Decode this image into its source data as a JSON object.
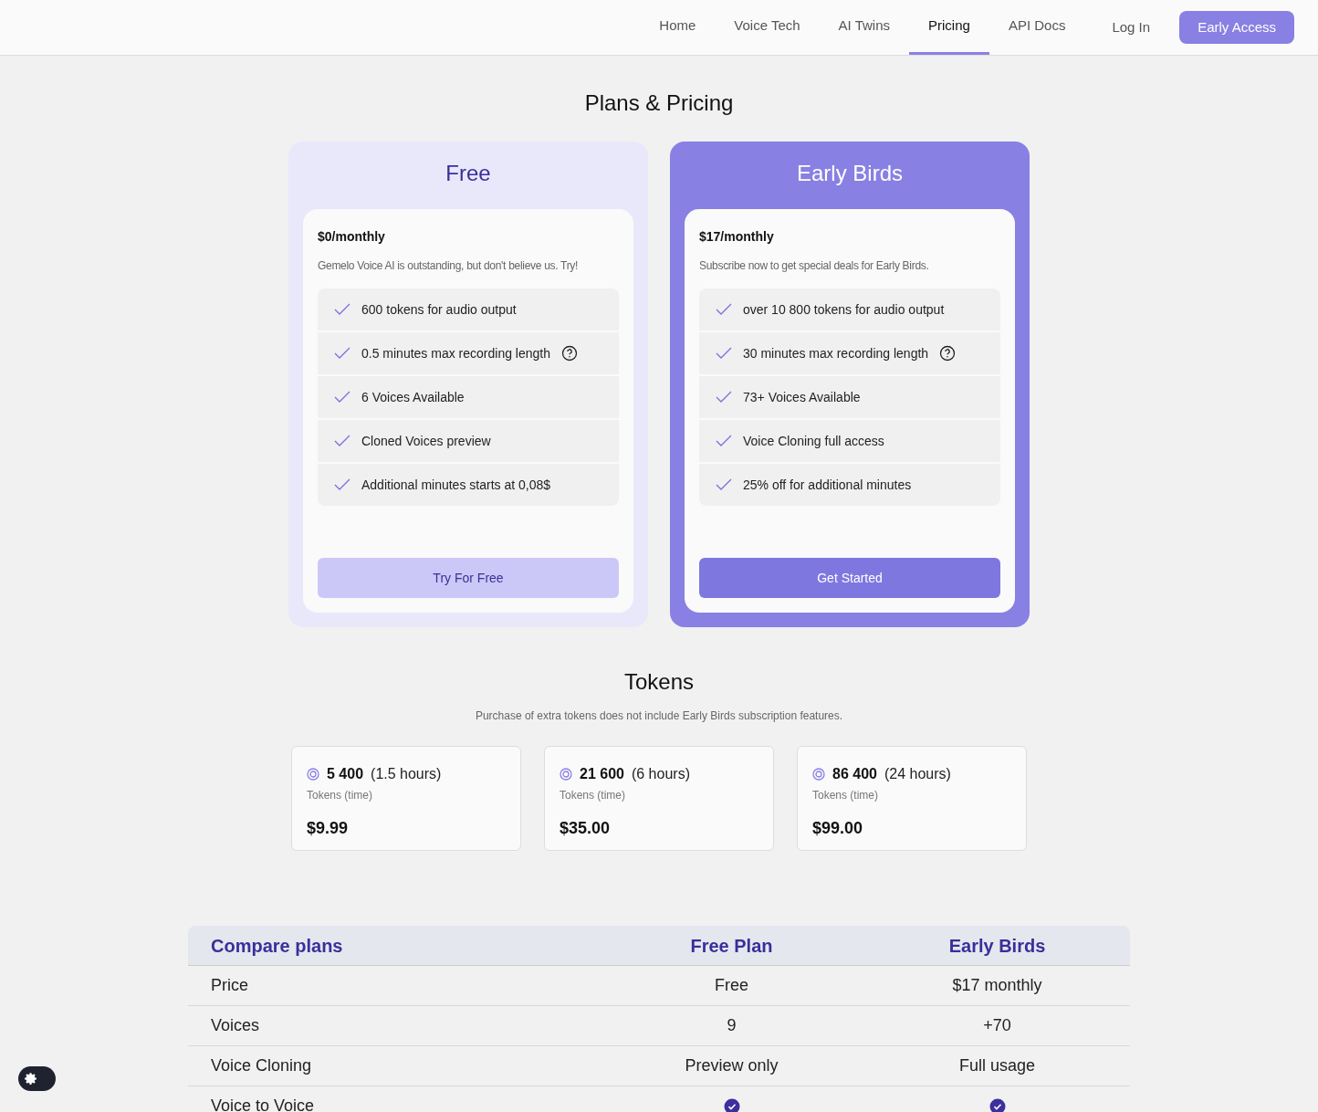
{
  "nav": {
    "links": [
      {
        "label": "Home",
        "selected": false
      },
      {
        "label": "Voice Tech",
        "selected": false
      },
      {
        "label": "AI Twins",
        "selected": false
      },
      {
        "label": "Pricing",
        "selected": true
      },
      {
        "label": "API Docs",
        "selected": false
      }
    ],
    "login": "Log In",
    "cta": "Early Access"
  },
  "title": "Plans & Pricing",
  "plans": [
    {
      "kind": "basic",
      "name": "Free",
      "price": "$0/monthly",
      "description": "Gemelo Voice AI is outstanding, but don't believe us. Try!",
      "features": [
        {
          "text": "600 tokens for audio output",
          "help": false
        },
        {
          "text": "0.5 minutes max recording length",
          "help": true
        },
        {
          "text": "6 Voices Available",
          "help": false
        },
        {
          "text": "Cloned Voices preview",
          "help": false
        },
        {
          "text": "Additional minutes starts at 0,08$",
          "help": false
        }
      ],
      "button": "Try For Free"
    },
    {
      "kind": "featured",
      "name": "Early Birds",
      "price": "$17/monthly",
      "description": "Subscribe now to get special deals for Early Birds.",
      "features": [
        {
          "text": "over 10 800 tokens for audio output",
          "help": false
        },
        {
          "text": "30 minutes max recording length",
          "help": true
        },
        {
          "text": "73+ Voices Available",
          "help": false
        },
        {
          "text": "Voice Cloning full access",
          "help": false
        },
        {
          "text": "25% off for additional minutes",
          "help": false
        }
      ],
      "button": "Get Started"
    }
  ],
  "tokens": {
    "title": "Tokens",
    "subtitle": "Purchase of extra tokens does not include Early Birds subscription features.",
    "packs": [
      {
        "amount": "5 400",
        "time": "(1.5 hours)",
        "label": "Tokens (time)",
        "price": "$9.99"
      },
      {
        "amount": "21 600",
        "time": "(6 hours)",
        "label": "Tokens (time)",
        "price": "$35.00"
      },
      {
        "amount": "86 400",
        "time": "(24 hours)",
        "label": "Tokens (time)",
        "price": "$99.00"
      }
    ]
  },
  "compare": {
    "columns": [
      "Compare plans",
      "Free Plan",
      "Early Birds"
    ],
    "rows": [
      {
        "cells": [
          {
            "kind": "text",
            "text": "Price"
          },
          {
            "kind": "text",
            "text": "Free"
          },
          {
            "kind": "text",
            "text": "$17 monthly"
          }
        ]
      },
      {
        "cells": [
          {
            "kind": "text",
            "text": "Voices"
          },
          {
            "kind": "text",
            "text": "9"
          },
          {
            "kind": "text",
            "text": "+70"
          }
        ]
      },
      {
        "cells": [
          {
            "kind": "text",
            "text": "Voice Cloning"
          },
          {
            "kind": "text",
            "text": "Preview only"
          },
          {
            "kind": "text",
            "text": "Full usage"
          }
        ]
      },
      {
        "cells": [
          {
            "kind": "text",
            "text": "Voice to Voice"
          },
          {
            "kind": "check"
          },
          {
            "kind": "check"
          }
        ]
      }
    ]
  },
  "theme_toggle": {
    "on": false
  }
}
